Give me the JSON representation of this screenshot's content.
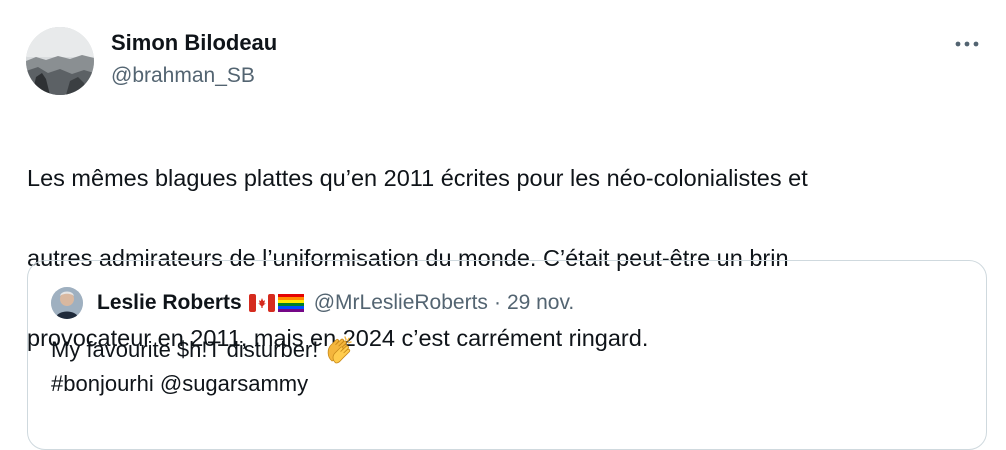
{
  "author": {
    "name": "Simon Bilodeau",
    "handle": "@brahman_SB"
  },
  "tweet": {
    "text_lines": [
      "Les mêmes blagues plattes qu’en 2011 écrites pour les néo-colonialistes et",
      "autres admirateurs de l’uniformisation du monde. C’était peut-être un brin",
      "provocateur en 2011, mais en 2024 c’est carrément ringard."
    ]
  },
  "more_menu": {
    "label": "···",
    "icon": "more-horizontal-icon"
  },
  "quoted_tweet": {
    "author_name": "Leslie Roberts",
    "flags": [
      "canada-flag-icon",
      "rainbow-flag-icon"
    ],
    "handle": "@MrLeslieRoberts",
    "separator": "·",
    "date": "29 nov.",
    "line1": "My favourite $h!T disturber!",
    "line1_emoji": "clapping-hands-icon",
    "line2": "#bonjourhi @sugarsammy"
  },
  "colors": {
    "text": "#0f1419",
    "secondary": "#536471",
    "border": "#cfd9de"
  }
}
